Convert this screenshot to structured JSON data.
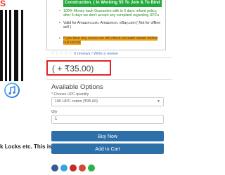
{
  "left": {
    "logo_fragment": "S",
    "bottom_caption": "k Locks etc. This is a"
  },
  "description": {
    "green_header": "Construction. ( In Working 55 To Join & To Bind",
    "bullets": [
      "100% Money back Guarantee with in 5 days refund policy, after 5 days we don't accept any complaint regarding UPCs",
      "Valid for Amazon.com, Amazon.in, eBay.com ( Not for offline sell )"
    ],
    "bullet3_highlight": "If you face any issues we will check on team viewer before Full refund"
  },
  "rating": {
    "stars": "☆☆☆☆☆",
    "reviews": "0 reviews",
    "separator": "/",
    "write_review": "Write a review"
  },
  "price": {
    "display": "( + ₹35.00)"
  },
  "options": {
    "title": "Available Options",
    "required_mark": "*",
    "choose_label": "Choose UPC quantity",
    "selected_value": "100 UPC codes (₹35.00)",
    "qty_label": "Qty",
    "qty_value": "1"
  },
  "buttons": {
    "buy_now": "Buy Now",
    "add_to_cart": "Add to Cart"
  },
  "colors": {
    "accent_button": "#2d6fa8",
    "highlight_box": "#e0242a",
    "green_banner": "#1faa3a"
  }
}
